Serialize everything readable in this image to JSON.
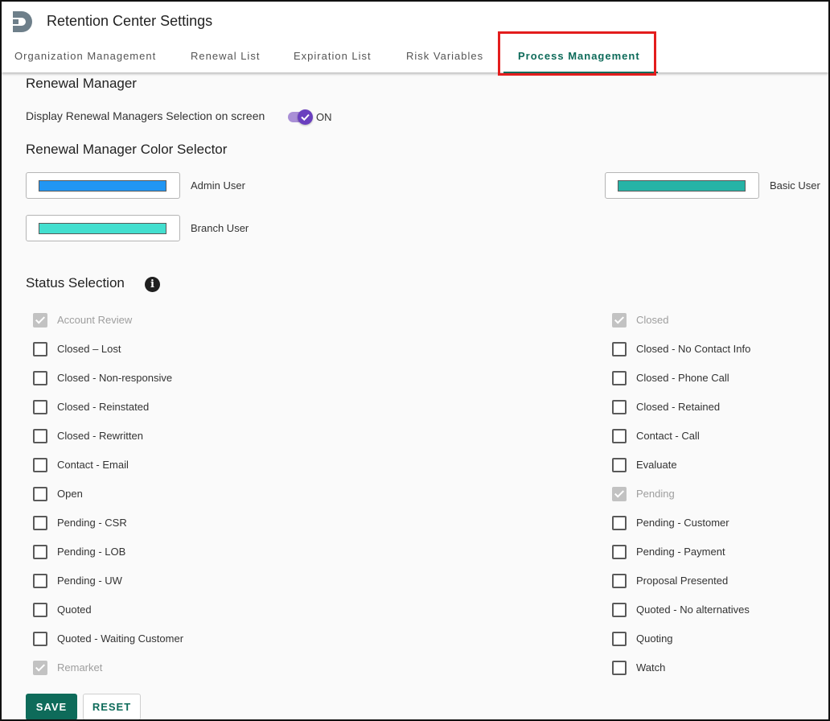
{
  "app": {
    "title": "Retention Center Settings"
  },
  "tabs": [
    {
      "label": "Organization Management",
      "active": false
    },
    {
      "label": "Renewal List",
      "active": false
    },
    {
      "label": "Expiration List",
      "active": false
    },
    {
      "label": "Risk Variables",
      "active": false
    },
    {
      "label": "Process Management",
      "active": true
    }
  ],
  "renewal_manager": {
    "title": "Renewal Manager",
    "toggle_label": "Display Renewal Managers Selection on screen",
    "toggle_state": "ON",
    "toggle_on": true
  },
  "color_selector": {
    "title": "Renewal Manager Color Selector",
    "users": [
      {
        "label": "Admin User",
        "color": "#2196f3"
      },
      {
        "label": "Basic User",
        "color": "#26b3a6"
      },
      {
        "label": "Branch User",
        "color": "#43dfcf"
      }
    ]
  },
  "status": {
    "title": "Status Selection",
    "left": [
      {
        "label": "Account Review",
        "checked": true,
        "disabled": true
      },
      {
        "label": "Closed – Lost",
        "checked": false,
        "disabled": false
      },
      {
        "label": "Closed - Non-responsive",
        "checked": false,
        "disabled": false
      },
      {
        "label": "Closed - Reinstated",
        "checked": false,
        "disabled": false
      },
      {
        "label": "Closed - Rewritten",
        "checked": false,
        "disabled": false
      },
      {
        "label": "Contact - Email",
        "checked": false,
        "disabled": false
      },
      {
        "label": "Open",
        "checked": false,
        "disabled": false
      },
      {
        "label": "Pending - CSR",
        "checked": false,
        "disabled": false
      },
      {
        "label": "Pending - LOB",
        "checked": false,
        "disabled": false
      },
      {
        "label": "Pending - UW",
        "checked": false,
        "disabled": false
      },
      {
        "label": "Quoted",
        "checked": false,
        "disabled": false
      },
      {
        "label": "Quoted - Waiting Customer",
        "checked": false,
        "disabled": false
      },
      {
        "label": "Remarket",
        "checked": true,
        "disabled": true
      }
    ],
    "right": [
      {
        "label": "Closed",
        "checked": true,
        "disabled": true
      },
      {
        "label": "Closed - No Contact Info",
        "checked": false,
        "disabled": false
      },
      {
        "label": "Closed - Phone Call",
        "checked": false,
        "disabled": false
      },
      {
        "label": "Closed - Retained",
        "checked": false,
        "disabled": false
      },
      {
        "label": "Contact - Call",
        "checked": false,
        "disabled": false
      },
      {
        "label": "Evaluate",
        "checked": false,
        "disabled": false
      },
      {
        "label": "Pending",
        "checked": true,
        "disabled": true
      },
      {
        "label": "Pending - Customer",
        "checked": false,
        "disabled": false
      },
      {
        "label": "Pending - Payment",
        "checked": false,
        "disabled": false
      },
      {
        "label": "Proposal Presented",
        "checked": false,
        "disabled": false
      },
      {
        "label": "Quoted - No alternatives",
        "checked": false,
        "disabled": false
      },
      {
        "label": "Quoting",
        "checked": false,
        "disabled": false
      },
      {
        "label": "Watch",
        "checked": false,
        "disabled": false
      }
    ]
  },
  "actions": {
    "save_label": "SAVE",
    "reset_label": "RESET"
  },
  "icons": {
    "logo": "d-magnet-logo-icon",
    "info": "info-icon",
    "check": "check-icon"
  }
}
